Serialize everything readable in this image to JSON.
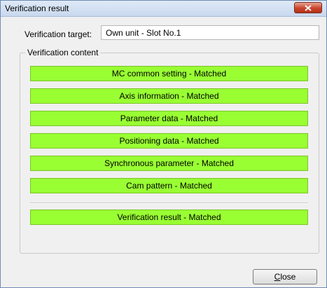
{
  "window": {
    "title": "Verification result"
  },
  "target": {
    "label": "Verification target:",
    "value": "Own unit - Slot No.1"
  },
  "content": {
    "legend": "Verification content",
    "items": [
      "MC common setting - Matched",
      "Axis information - Matched",
      "Parameter data - Matched",
      "Positioning data - Matched",
      "Synchronous parameter - Matched",
      "Cam pattern - Matched"
    ],
    "overall": "Verification result - Matched"
  },
  "buttons": {
    "close_mnemonic": "C",
    "close_rest": "lose"
  },
  "colors": {
    "matched": "#99ff33"
  }
}
